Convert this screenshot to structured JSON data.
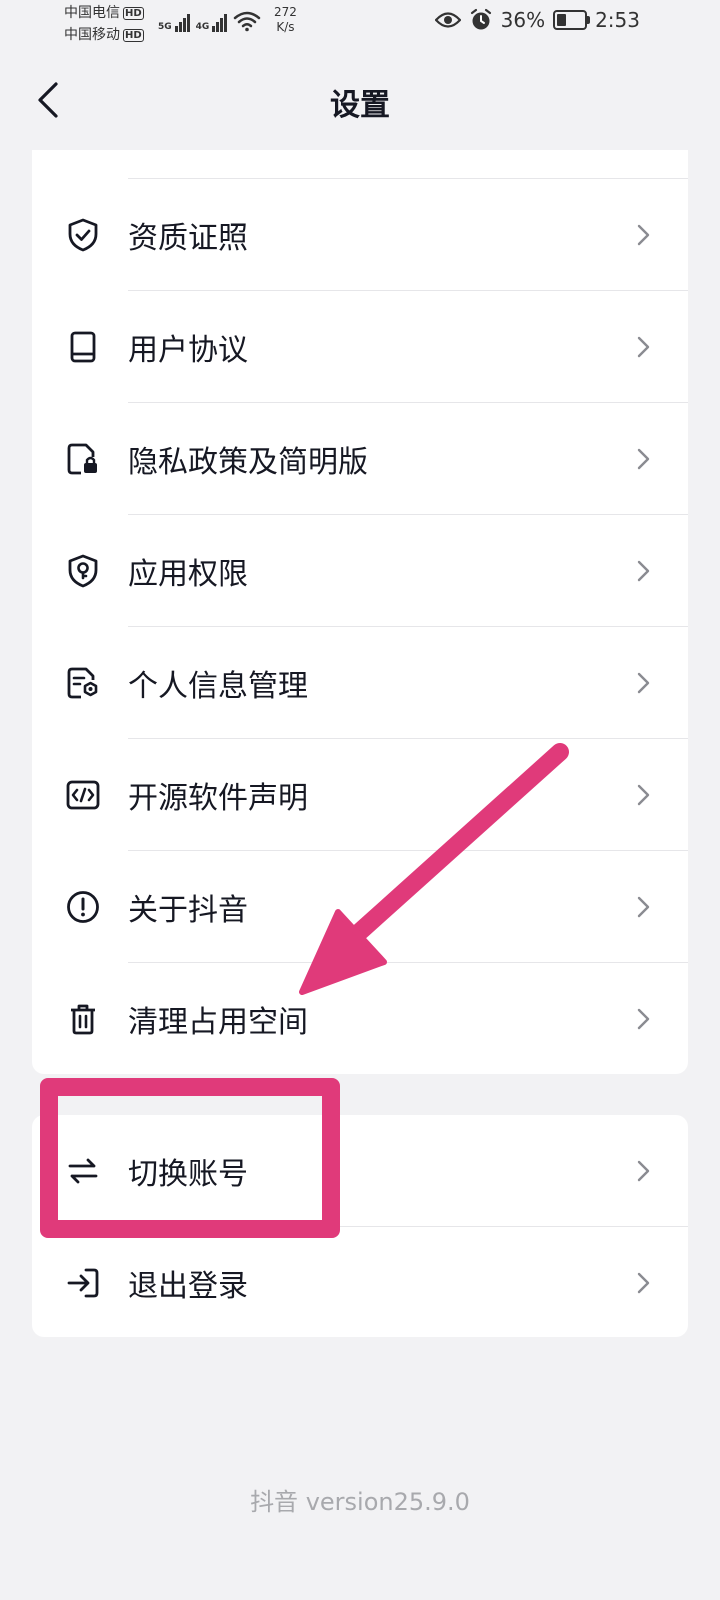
{
  "status_bar": {
    "carrier_1": "中国电信",
    "carrier_2": "中国移动",
    "hd_badge": "HD",
    "net_5g": "5G",
    "net_4g": "4G",
    "speed_value": "272",
    "speed_unit": "K/s",
    "battery_percent": "36%",
    "battery_level": 0.36,
    "time": "2:53"
  },
  "header": {
    "title": "设置"
  },
  "settings_list": [
    {
      "icon": "shield-check-icon",
      "label": "资质证照"
    },
    {
      "icon": "book-icon",
      "label": "用户协议"
    },
    {
      "icon": "file-lock-icon",
      "label": "隐私政策及简明版"
    },
    {
      "icon": "shield-key-icon",
      "label": "应用权限"
    },
    {
      "icon": "file-settings-icon",
      "label": "个人信息管理"
    },
    {
      "icon": "code-icon",
      "label": "开源软件声明"
    },
    {
      "icon": "info-icon",
      "label": "关于抖音"
    },
    {
      "icon": "trash-icon",
      "label": "清理占用空间"
    }
  ],
  "account_list": [
    {
      "icon": "switch-arrows-icon",
      "label": "切换账号"
    },
    {
      "icon": "logout-icon",
      "label": "退出登录"
    }
  ],
  "footer": {
    "version": "抖音 version25.9.0"
  },
  "colors": {
    "annotation": "#e03a7a",
    "background": "#f2f2f4",
    "card": "#ffffff"
  }
}
